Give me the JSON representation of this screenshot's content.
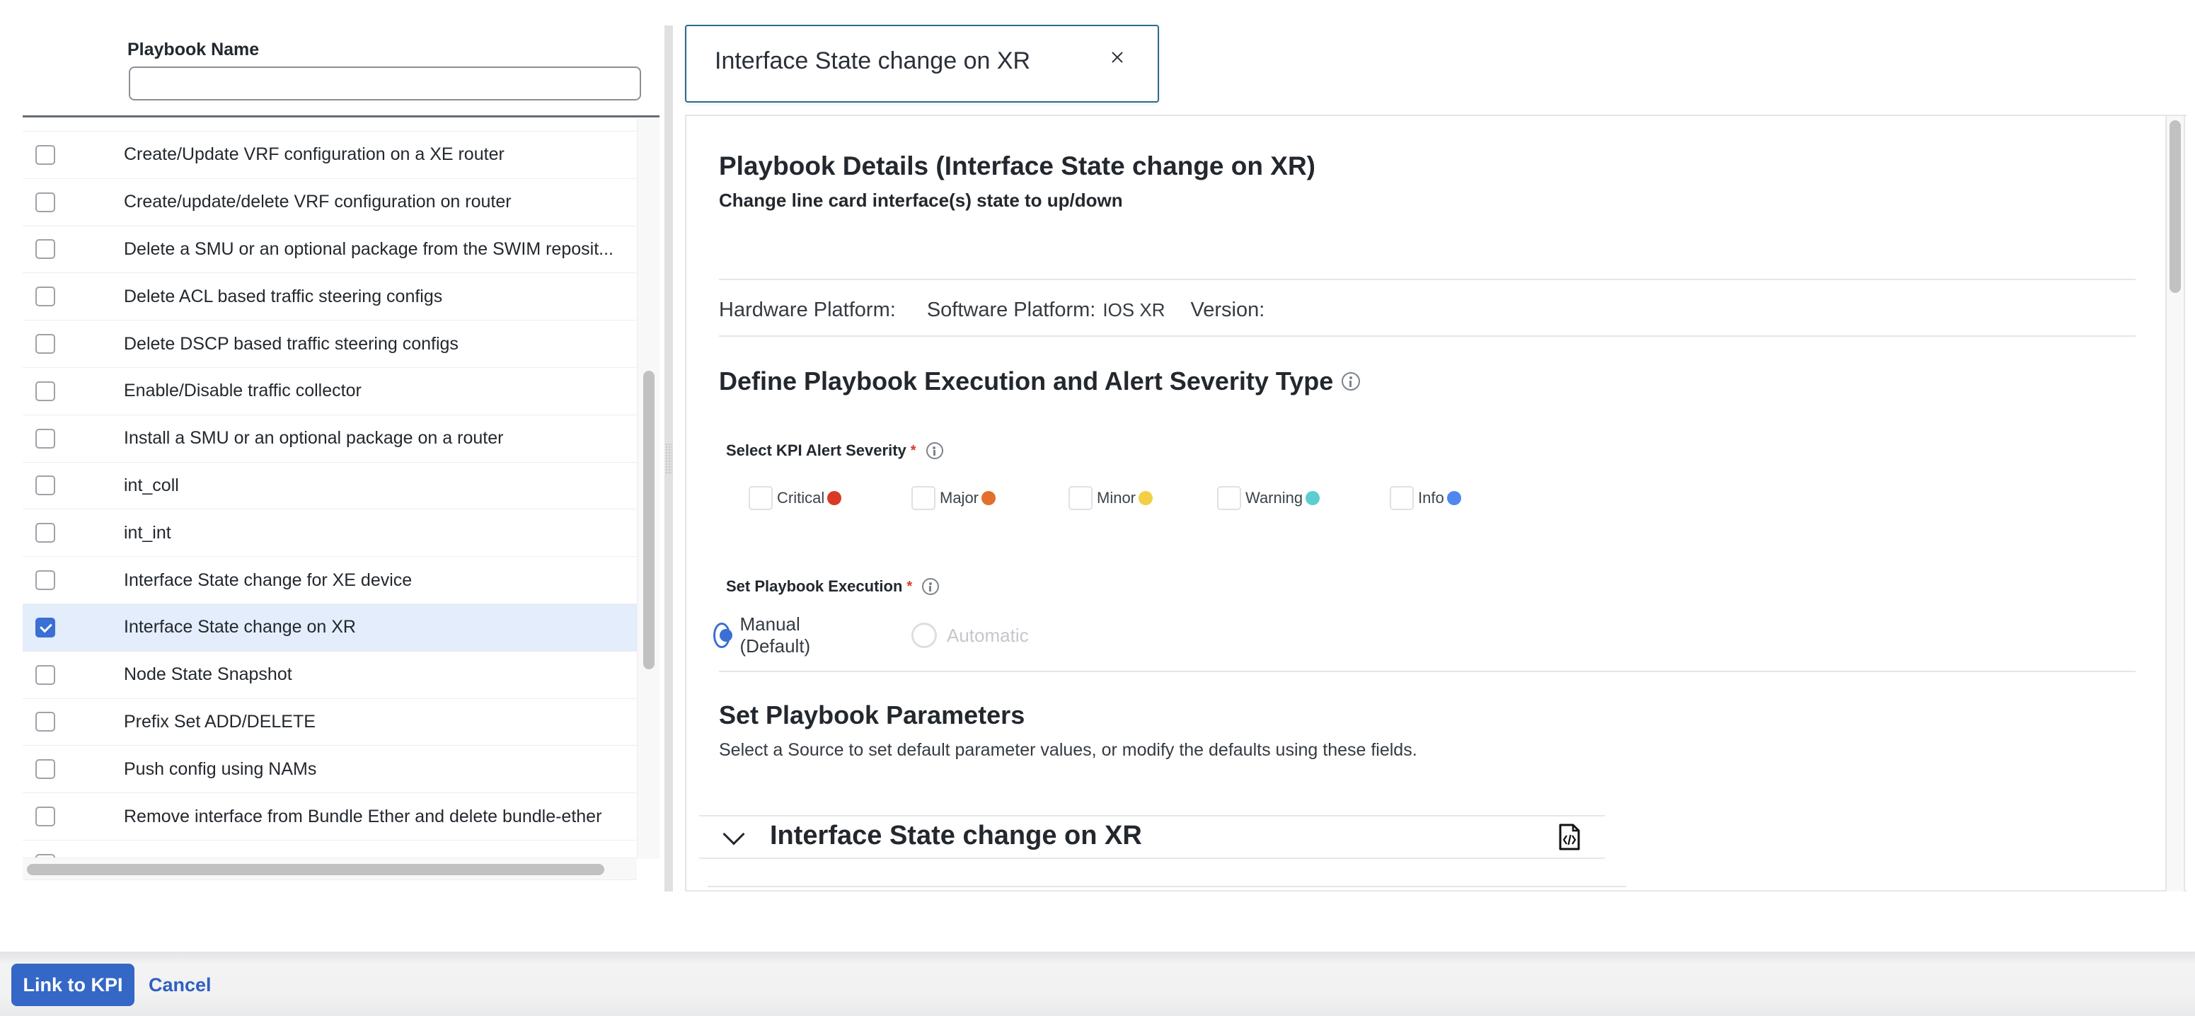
{
  "left_panel": {
    "column_header": "Playbook Name",
    "filter": {
      "value": "",
      "placeholder": ""
    },
    "rows": [
      {
        "label": "Create/Update VRF configuration on a XE router",
        "checked": false
      },
      {
        "label": "Create/update/delete VRF configuration on router",
        "checked": false
      },
      {
        "label": "Delete a SMU or an optional package from the SWIM reposit...",
        "checked": false
      },
      {
        "label": "Delete ACL based traffic steering configs",
        "checked": false
      },
      {
        "label": "Delete DSCP based traffic steering configs",
        "checked": false
      },
      {
        "label": "Enable/Disable traffic collector",
        "checked": false
      },
      {
        "label": "Install a SMU or an optional package on a router",
        "checked": false
      },
      {
        "label": "int_coll",
        "checked": false
      },
      {
        "label": "int_int",
        "checked": false
      },
      {
        "label": "Interface State change for XE device",
        "checked": false
      },
      {
        "label": "Interface State change on XR",
        "checked": true
      },
      {
        "label": "Node State Snapshot",
        "checked": false
      },
      {
        "label": "Prefix Set ADD/DELETE",
        "checked": false
      },
      {
        "label": "Push config using NAMs",
        "checked": false
      },
      {
        "label": "Remove interface from Bundle Ether and delete bundle-ether",
        "checked": false
      },
      {
        "label": "",
        "checked": false
      }
    ]
  },
  "tab": {
    "title": "Interface State change on XR",
    "close_icon": "close-icon"
  },
  "details": {
    "title": "Playbook Details (Interface State change on XR)",
    "subtitle": "Change line card interface(s) state to up/down",
    "hardware_platform_label": "Hardware Platform:",
    "hardware_platform_value": "",
    "software_platform_label": "Software Platform:",
    "software_platform_value": "IOS XR",
    "version_label": "Version:",
    "version_value": ""
  },
  "execution_section": {
    "title": "Define Playbook Execution and Alert Severity Type",
    "severity_label": "Select KPI Alert Severity",
    "required_mark": "*",
    "severities": [
      {
        "label": "Critical",
        "color": "#d93a26",
        "checked": false
      },
      {
        "label": "Major",
        "color": "#e0702b",
        "checked": false
      },
      {
        "label": "Minor",
        "color": "#f3cf45",
        "checked": false
      },
      {
        "label": "Warning",
        "color": "#5ccdd0",
        "checked": false
      },
      {
        "label": "Info",
        "color": "#4f86f0",
        "checked": false
      }
    ],
    "execution_label": "Set Playbook Execution",
    "execution_options": [
      {
        "label": "Manual (Default)",
        "selected": true,
        "disabled": false
      },
      {
        "label": "Automatic",
        "selected": false,
        "disabled": true
      }
    ]
  },
  "parameters_section": {
    "title": "Set Playbook Parameters",
    "description": "Select a Source to set default parameter values, or modify the defaults using these fields.",
    "accordion_title": "Interface State change on XR",
    "accordion_expanded": true,
    "code_icon": "code-file-icon"
  },
  "footer": {
    "primary_label": "Link to KPI",
    "cancel_label": "Cancel"
  },
  "colors": {
    "accent": "#3467c6",
    "selected_row": "#e3edfb",
    "tab_border": "#2b6a8f",
    "required": "#d43a28"
  }
}
